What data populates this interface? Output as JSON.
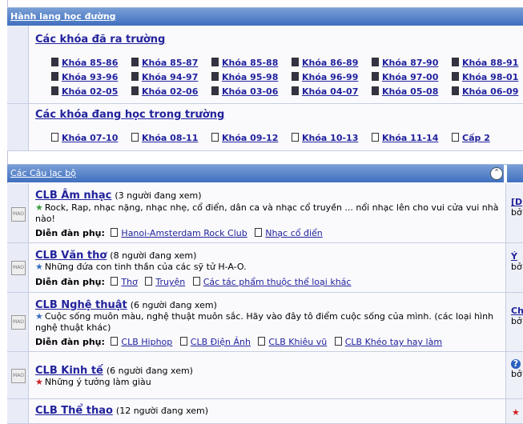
{
  "hall": {
    "header": "Hành lang học đường",
    "graduated": {
      "title": "Các khóa đã ra trường",
      "items": [
        "Khóa 85-86",
        "Khóa 85-87",
        "Khóa 85-88",
        "Khóa 86-89",
        "Khóa 87-90",
        "Khóa 88-91",
        "Khóa 93-96",
        "Khóa 94-97",
        "Khóa 95-98",
        "Khóa 96-99",
        "Khóa 97-00",
        "Khóa 98-01",
        "Khóa 02-05",
        "Khóa 02-06",
        "Khóa 03-06",
        "Khóa 04-07",
        "Khóa 05-08",
        "Khóa 06-09"
      ]
    },
    "current": {
      "title": "Các khóa đang học trong trường",
      "items": [
        "Khóa 07-10",
        "Khóa 08-11",
        "Khóa 09-12",
        "Khóa 10-13",
        "Khóa 11-14",
        "Cấp 2"
      ]
    }
  },
  "clubs": {
    "header": "Các Câu lạc bộ",
    "collapse_icon": "collapse-icon",
    "subs_label": "Diễn đàn phụ:",
    "forums": [
      {
        "name": "CLB Âm nhạc",
        "viewers": "(3 người đang xem)",
        "desc": "Rock, Rap, nhạc nặng, nhạc nhẹ, cổ điển, dân ca và nhạc cổ truyền ... nổi nhạc lên cho vui cửa vui nhà nào!",
        "subs": [
          "Hanoi-Amsterdam Rock Club",
          "Nhạc cổ điển"
        ],
        "side_title": "[D",
        "side_by": "bở"
      },
      {
        "name": "CLB Văn thơ",
        "viewers": "(8 người đang xem)",
        "desc": "Những đứa con tinh thần của các sỹ tử H-A-O.",
        "subs": [
          "Thơ",
          "Truyện",
          "Các tác phẩm thuộc thể loại khác"
        ],
        "side_title": "Ý",
        "side_by": "bở"
      },
      {
        "name": "CLB Nghệ thuật",
        "viewers": "(6 người đang xem)",
        "desc": "Cuộc sống muôn màu, nghệ thuật muôn sắc. Hãy vào đây tô điểm cuộc sống của mình. (các loại hình nghệ thuật khác)",
        "subs": [
          "CLB Hiphop",
          "CLB Điện Ảnh",
          "CLB Khiêu vũ",
          "CLB Khéo tay hay làm"
        ],
        "side_title": "Ch",
        "side_by": "bở"
      },
      {
        "name": "CLB Kinh tế",
        "viewers": "(6 người đang xem)",
        "desc": "Những ý tưởng làm giàu",
        "side_title": "?",
        "side_by": "bở"
      },
      {
        "name": "CLB Thể thao",
        "viewers": "(12 người đang xem)",
        "desc": ""
      }
    ]
  }
}
